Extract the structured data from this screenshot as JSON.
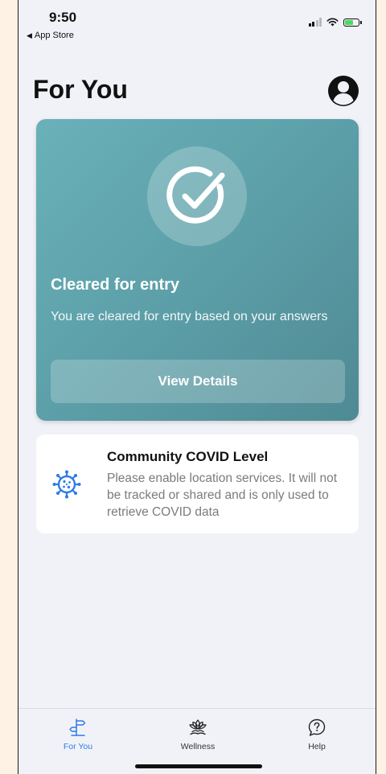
{
  "status_bar": {
    "time": "9:50",
    "back_label": "App Store"
  },
  "header": {
    "title": "For You"
  },
  "status_card": {
    "heading": "Cleared for entry",
    "description": "You are cleared for entry based on your answers",
    "button_label": "View Details",
    "colors": {
      "gradient_start": "#6ab1b9",
      "gradient_end": "#4f8a94"
    }
  },
  "covid_card": {
    "title": "Community COVID Level",
    "description": "Please enable location services. It will not be tracked or shared and is only used to retrieve COVID data",
    "icon": "virus-icon",
    "icon_color": "#2f7be6"
  },
  "tab_bar": {
    "items": [
      {
        "label": "For You",
        "icon": "signpost-icon",
        "active": true
      },
      {
        "label": "Wellness",
        "icon": "lotus-icon",
        "active": false
      },
      {
        "label": "Help",
        "icon": "help-bubble-icon",
        "active": false
      }
    ],
    "active_color": "#2f7be6"
  }
}
